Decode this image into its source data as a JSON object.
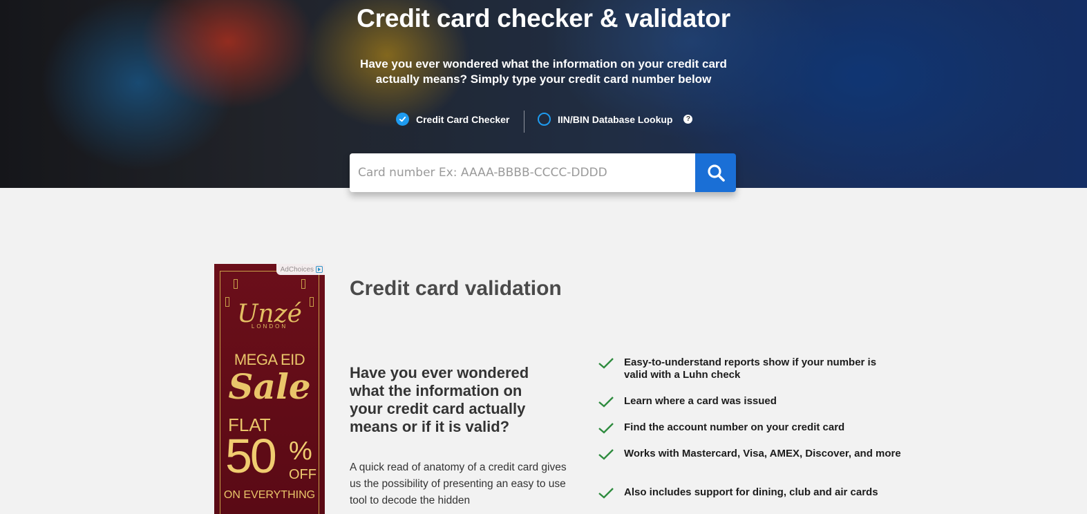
{
  "hero": {
    "title": "Credit card checker & validator",
    "subtitle": "Have you ever wondered what the information on your credit card actually means? Simply type your credit card number below",
    "options": [
      {
        "label": "Credit Card Checker",
        "selected": true
      },
      {
        "label": "IIN/BIN Database Lookup",
        "selected": false,
        "help_icon": "question-icon"
      }
    ],
    "search": {
      "placeholder": "Card number Ex: AAAA-BBBB-CCCC-DDDD",
      "value": "",
      "button_icon": "search-icon"
    }
  },
  "ad": {
    "adchoices": "AdChoices",
    "brand": "Unzé",
    "brand_sub": "LONDON",
    "mega": "MEGA EID",
    "sale": "Sale",
    "flat": "FLAT",
    "discount": "50",
    "percent": "%",
    "off": "OFF",
    "everything": "ON EVERYTHING"
  },
  "main": {
    "section_title": "Credit card validation",
    "left_heading": "Have you ever wondered what the information on your credit card actually means or if it is valid?",
    "left_paragraph": "A quick read of anatomy of a credit card gives us the possibility of presenting an easy to use tool to decode the hidden",
    "features": [
      "Easy-to-understand reports show if your number is valid with a Luhn check",
      "Learn where a card was issued",
      "Find the account number on your credit card",
      "Works with Mastercard, Visa, AMEX, Discover, and more",
      "Also includes support for dining, club and air cards"
    ]
  },
  "colors": {
    "accent": "#1a6fd6",
    "radio": "#1e9bf0",
    "check": "#2e8b3e",
    "ad_bg": "#6b0f1a",
    "ad_gold": "#e9c56a"
  }
}
